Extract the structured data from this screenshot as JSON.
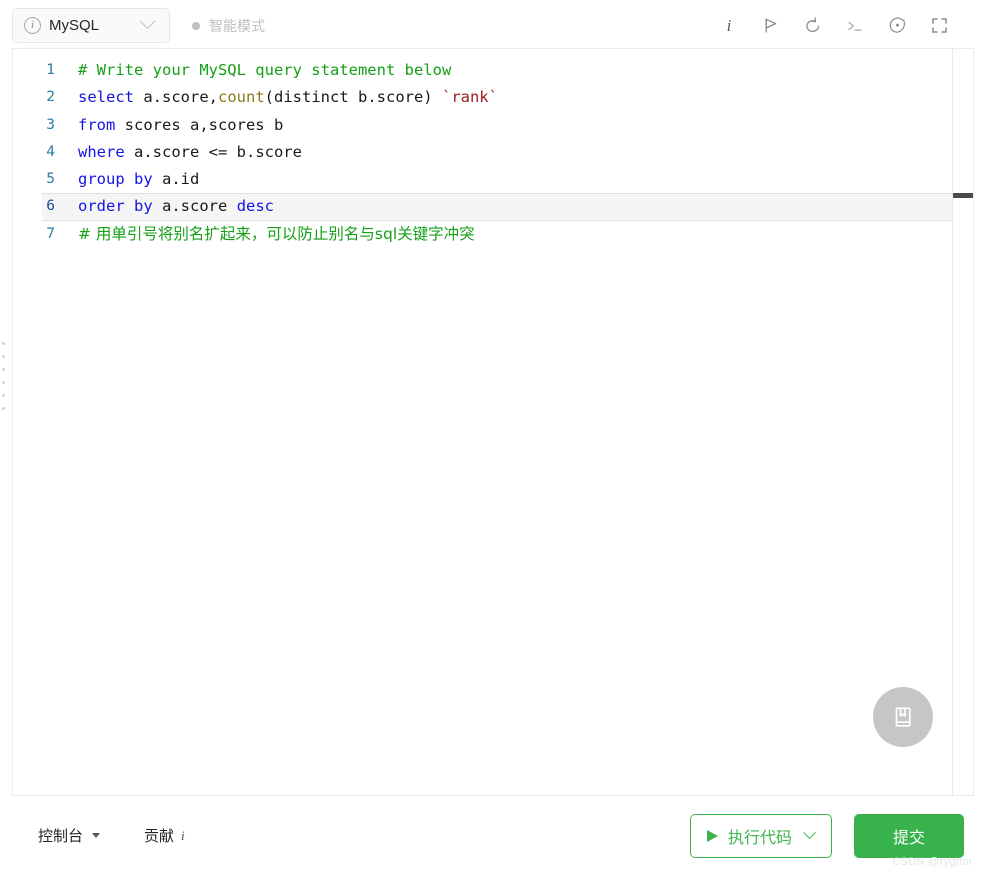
{
  "topbar": {
    "language_selector": {
      "label": "MySQL",
      "info_icon": "info-circle-icon",
      "chevron_icon": "chevron-down-icon"
    },
    "mode": {
      "dot_icon": "status-dot-icon",
      "label": "智能模式"
    },
    "icons": [
      {
        "name": "info-icon",
        "glyph": "i",
        "title": "info"
      },
      {
        "name": "flag-icon",
        "glyph": "flag",
        "title": "flag"
      },
      {
        "name": "reset-icon",
        "glyph": "undo",
        "title": "reset"
      },
      {
        "name": "terminal-icon",
        "glyph": ">_",
        "title": "console"
      },
      {
        "name": "settings-icon",
        "glyph": "gear",
        "title": "settings"
      },
      {
        "name": "fullscreen-icon",
        "glyph": "expand",
        "title": "fullscreen"
      }
    ]
  },
  "editor": {
    "active_line": 6,
    "lines": [
      {
        "num": "1",
        "tokens": [
          {
            "t": "# Write your MySQL query statement below",
            "c": "com"
          }
        ]
      },
      {
        "num": "2",
        "tokens": [
          {
            "t": "select",
            "c": "kw"
          },
          {
            "t": " a.score,",
            "c": "pl"
          },
          {
            "t": "count",
            "c": "fn"
          },
          {
            "t": "(distinct b.score) ",
            "c": "pl"
          },
          {
            "t": "`rank`",
            "c": "str"
          }
        ]
      },
      {
        "num": "3",
        "tokens": [
          {
            "t": "from",
            "c": "kw"
          },
          {
            "t": " scores a,scores b",
            "c": "pl"
          }
        ]
      },
      {
        "num": "4",
        "tokens": [
          {
            "t": "where",
            "c": "kw"
          },
          {
            "t": " a.score <= b.score",
            "c": "pl"
          }
        ]
      },
      {
        "num": "5",
        "tokens": [
          {
            "t": "group",
            "c": "kw"
          },
          {
            "t": " ",
            "c": "pl"
          },
          {
            "t": "by",
            "c": "kw"
          },
          {
            "t": " a.id",
            "c": "pl"
          }
        ]
      },
      {
        "num": "6",
        "tokens": [
          {
            "t": "order",
            "c": "kw"
          },
          {
            "t": " ",
            "c": "pl"
          },
          {
            "t": "by",
            "c": "kw"
          },
          {
            "t": " a.score ",
            "c": "pl"
          },
          {
            "t": "desc",
            "c": "kw"
          }
        ]
      },
      {
        "num": "7",
        "tokens": [
          {
            "t": "# 用单引号将别名扩起来，可以防止别名与sql关键字冲突",
            "c": "com"
          }
        ]
      }
    ],
    "notebook_button": {
      "icon": "notebook-icon"
    },
    "drag_handle": {
      "icon": "drag-handle-icon",
      "dots": 6
    },
    "minimap": {
      "marker_label": ""
    }
  },
  "bottombar": {
    "console_label": "控制台",
    "console_caret_icon": "caret-down-icon",
    "contribute_label": "贡献",
    "contribute_info_icon": "info-italic-icon",
    "run_label": "执行代码",
    "run_play_icon": "play-icon",
    "run_chevron_icon": "chevron-down-icon",
    "submit_label": "提交"
  },
  "watermark": "CSDN @rygttm",
  "colors": {
    "accent_green": "#37b24d",
    "run_border_green": "#3cb44a",
    "comment_green": "#15a015",
    "keyword_blue": "#1414e6",
    "function_olive": "#8a7a1b",
    "string_red": "#9c1b1b",
    "linenum_blue": "#2b7ba3",
    "muted_gray": "#bfbfbf"
  }
}
